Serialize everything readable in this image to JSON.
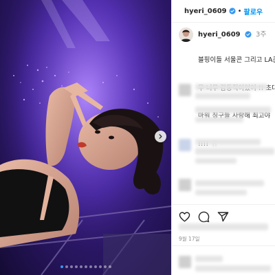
{
  "post": {
    "username": "hyeri_0609",
    "follow_label": "팔로우",
    "separator": "•",
    "time_ago": "3주",
    "caption_lines": [
      "블핑이들 서울콘 그리고 LA콘",
      "무 너무 감동적이었어 !! 초대",
      "마워 칭구들 사랑해 최고야",
      "!!!! 🦷"
    ],
    "date": "9월 17일"
  },
  "media": {
    "image_count": 11,
    "active_index": 0
  },
  "icons": {
    "verified": "verified-badge-icon",
    "like": "heart-icon",
    "comment": "comment-icon",
    "share": "paper-plane-icon",
    "next": "chevron-right-icon"
  },
  "colors": {
    "accent": "#0095f6",
    "verified": "#3897f0",
    "concert_purple": "#5a34c2"
  }
}
